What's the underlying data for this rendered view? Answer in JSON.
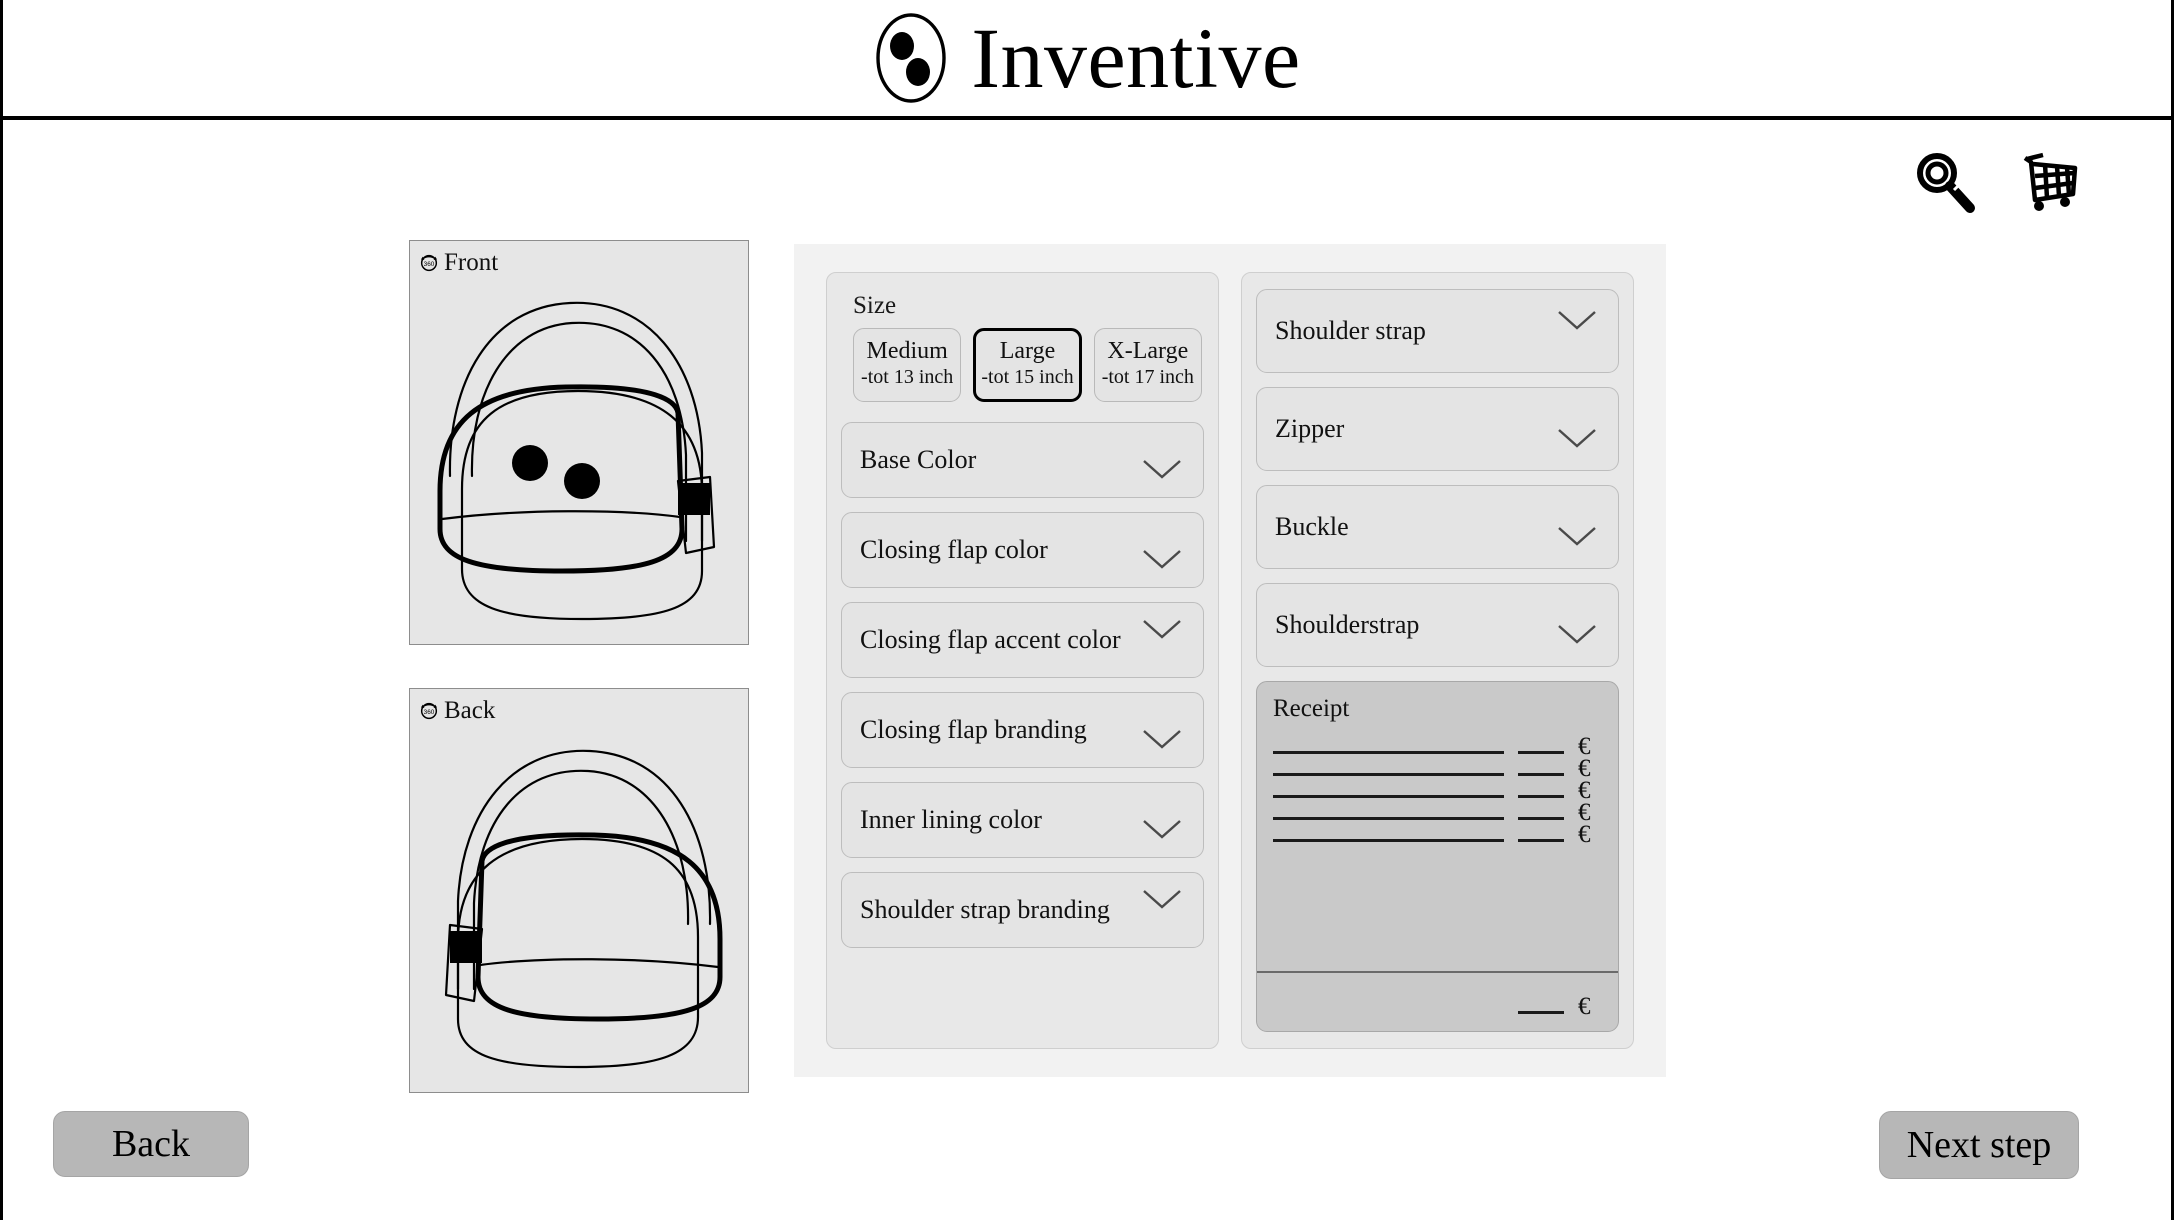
{
  "header": {
    "brand_name": "Inventive",
    "logo_icon": "inventive-logo-two-dots"
  },
  "toolbar": {
    "search_icon": "magnifier-icon",
    "cart_icon": "shopping-cart-icon"
  },
  "previews": [
    {
      "label": "Front",
      "rotate_icon": "360-rotate-icon",
      "view": "front"
    },
    {
      "label": "Back",
      "rotate_icon": "360-rotate-icon",
      "view": "back"
    }
  ],
  "configurator": {
    "size_group": {
      "title": "Size",
      "options": [
        {
          "name": "Medium",
          "sub": "-tot 13 inch",
          "selected": false
        },
        {
          "name": "Large",
          "sub": "-tot 15 inch",
          "selected": true
        },
        {
          "name": "X-Large",
          "sub": "-tot 17 inch",
          "selected": false
        }
      ]
    },
    "left_column": [
      {
        "label": "Base Color",
        "chevron": "chevron-down-icon"
      },
      {
        "label": "Closing flap color",
        "chevron": "chevron-down-icon"
      },
      {
        "label": "Closing flap accent color",
        "chevron": "chevron-down-icon"
      },
      {
        "label": "Closing flap branding",
        "chevron": "chevron-down-icon"
      },
      {
        "label": "Inner lining color",
        "chevron": "chevron-down-icon"
      },
      {
        "label": "Shoulder strap branding",
        "chevron": "chevron-down-icon"
      }
    ],
    "right_column": [
      {
        "label": "Shoulder strap",
        "chevron": "chevron-down-icon"
      },
      {
        "label": "Zipper",
        "chevron": "chevron-down-icon"
      },
      {
        "label": "Buckle",
        "chevron": "chevron-down-icon"
      },
      {
        "label": "Shoulderstrap",
        "chevron": "chevron-down-icon"
      }
    ],
    "receipt": {
      "title": "Receipt",
      "currency": "€",
      "line_count": 5,
      "lines": [
        {
          "description": "",
          "amount": "",
          "currency": "€"
        },
        {
          "description": "",
          "amount": "",
          "currency": "€"
        },
        {
          "description": "",
          "amount": "",
          "currency": "€"
        },
        {
          "description": "",
          "amount": "",
          "currency": "€"
        },
        {
          "description": "",
          "amount": "",
          "currency": "€"
        }
      ],
      "total": {
        "amount": "",
        "currency": "€"
      }
    }
  },
  "footer": {
    "back_label": "Back",
    "next_label": "Next step"
  },
  "colors": {
    "page_bg": "#ffffff",
    "panel_bg": "#f2f2f2",
    "card_bg": "#e8e8e8",
    "control_bg": "#e4e4e4",
    "preview_bg": "#e6e6e6",
    "receipt_bg": "#c9c9c9",
    "nav_button_bg": "#b7b7b7",
    "ink": "#000000"
  }
}
